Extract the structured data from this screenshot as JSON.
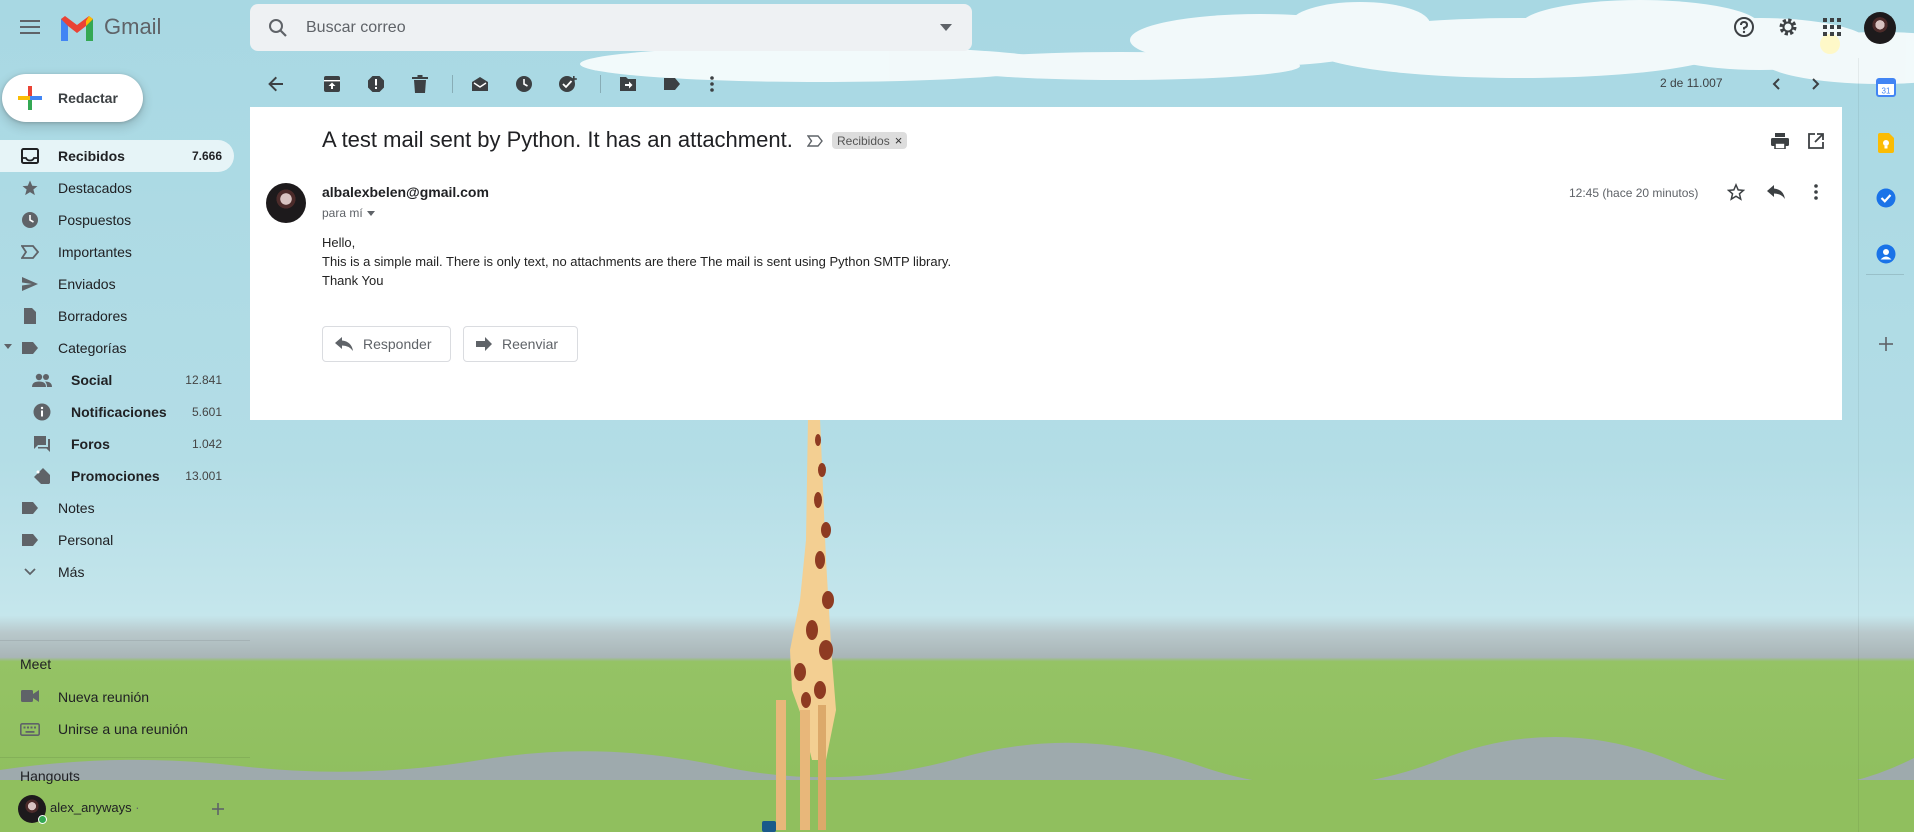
{
  "app": {
    "logo_text": "Gmail"
  },
  "search": {
    "placeholder": "Buscar correo"
  },
  "compose": {
    "label": "Redactar"
  },
  "sidebar": {
    "items": [
      {
        "label": "Recibidos",
        "count": "7.666"
      },
      {
        "label": "Destacados",
        "count": ""
      },
      {
        "label": "Pospuestos",
        "count": ""
      },
      {
        "label": "Importantes",
        "count": ""
      },
      {
        "label": "Enviados",
        "count": ""
      },
      {
        "label": "Borradores",
        "count": ""
      },
      {
        "label": "Categorías",
        "count": ""
      },
      {
        "label": "Social",
        "count": "12.841"
      },
      {
        "label": "Notificaciones",
        "count": "5.601"
      },
      {
        "label": "Foros",
        "count": "1.042"
      },
      {
        "label": "Promociones",
        "count": "13.001"
      },
      {
        "label": "Notes",
        "count": ""
      },
      {
        "label": "Personal",
        "count": ""
      },
      {
        "label": "Más",
        "count": ""
      }
    ]
  },
  "meet": {
    "title": "Meet",
    "new_meeting": "Nueva reunión",
    "join_meeting": "Unirse a una reunión"
  },
  "hangouts": {
    "title": "Hangouts",
    "user": "alex_anyways",
    "status": "·"
  },
  "toolbar": {
    "pager": "2 de 11.007"
  },
  "email": {
    "subject": "A test mail sent by Python. It has an attachment.",
    "label": "Recibidos",
    "label_close": "×",
    "sender": "albalexbelen@gmail.com",
    "to": "para mí",
    "time": "12:45 (hace 20 minutos)",
    "body": [
      "Hello,",
      "This is a simple mail. There is only text, no attachments are there The mail is sent using Python SMTP library.",
      "Thank You"
    ],
    "reply_label": "Responder",
    "forward_label": "Reenviar"
  },
  "colors": {
    "accent_red": "#ea4335",
    "text": "#202124",
    "sky": "#a8d8e3",
    "grass": "#8dbd5c"
  }
}
